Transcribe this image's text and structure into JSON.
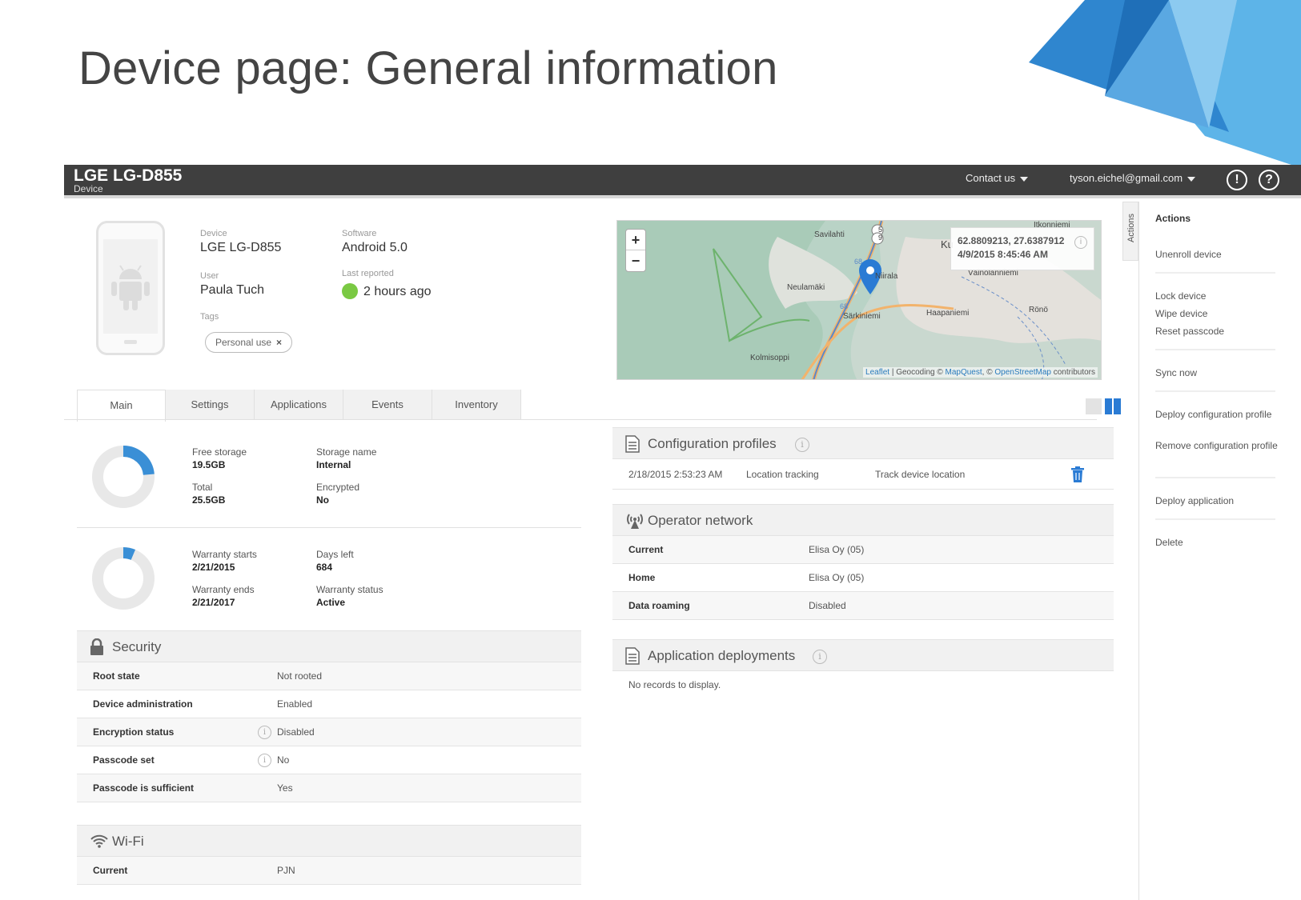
{
  "slide_title": "Device page: General information",
  "colors": {
    "topbar": "#3f3f3f",
    "accent_blue": "#3a8fd6",
    "green_status": "#7ac943",
    "donut_bg": "#e8e8e8"
  },
  "topbar": {
    "device_name": "LGE LG-D855",
    "device_sub": "Device",
    "contact_label": "Contact us",
    "user_email": "tyson.eichel@gmail.com",
    "alert_glyph": "!",
    "help_glyph": "?"
  },
  "device_info": {
    "device_label": "Device",
    "device_value": "LGE LG-D855",
    "software_label": "Software",
    "software_value": "Android 5.0",
    "user_label": "User",
    "user_value": "Paula Tuch",
    "last_reported_label": "Last reported",
    "last_reported_value": "2 hours ago",
    "tags_label": "Tags",
    "tag": "Personal use",
    "tag_remove": "×"
  },
  "map": {
    "zoom_in": "+",
    "zoom_out": "−",
    "coords": "62.8809213, 27.6387912",
    "timestamp": "4/9/2015 8:45:46 AM",
    "info_glyph": "i",
    "attr_leaflet": "Leaflet",
    "attr_geocoding": " | Geocoding © ",
    "attr_mapquest": "MapQuest",
    "attr_osm_prefix": ", © ",
    "attr_osm": "OpenStreetMap",
    "attr_contrib": " contributors",
    "places": [
      "Savilahti",
      "Itkonniemi",
      "Ku",
      "Neulamäki",
      "Niirala",
      "Väinölänniemi",
      "Särkiniemi",
      "Haapaniemi",
      "Rönö",
      "Kolmisoppi"
    ],
    "road_labels": [
      "5",
      "9",
      "68",
      "68"
    ]
  },
  "tabs": [
    "Main",
    "Settings",
    "Applications",
    "Events",
    "Inventory"
  ],
  "storage": {
    "free_label": "Free storage",
    "free_value": "19.5GB",
    "total_label": "Total",
    "total_value": "25.5GB",
    "name_label": "Storage name",
    "name_value": "Internal",
    "encrypted_label": "Encrypted",
    "encrypted_value": "No",
    "used_fraction": 0.235
  },
  "warranty": {
    "starts_label": "Warranty starts",
    "starts_value": "2/21/2015",
    "ends_label": "Warranty ends",
    "ends_value": "2/21/2017",
    "days_label": "Days left",
    "days_value": "684",
    "status_label": "Warranty status",
    "status_value": "Active",
    "elapsed_fraction": 0.063
  },
  "security": {
    "title": "Security",
    "rows": [
      {
        "key": "Root state",
        "value": "Not rooted"
      },
      {
        "key": "Device administration",
        "value": "Enabled"
      },
      {
        "key": "Encryption status",
        "value": "Disabled"
      },
      {
        "key": "Passcode set",
        "value": "No"
      },
      {
        "key": "Passcode is sufficient",
        "value": "Yes"
      }
    ]
  },
  "wifi": {
    "title": "Wi-Fi",
    "rows": [
      {
        "key": "Current",
        "value": "PJN"
      }
    ]
  },
  "config_profiles": {
    "title": "Configuration profiles",
    "info_glyph": "i",
    "rows": [
      {
        "date": "2/18/2015 2:53:23 AM",
        "name": "Location tracking",
        "description": "Track device location"
      }
    ]
  },
  "operator_network": {
    "title": "Operator network",
    "rows": [
      {
        "key": "Current",
        "value": "Elisa Oy (05)"
      },
      {
        "key": "Home",
        "value": "Elisa Oy (05)"
      },
      {
        "key": "Data roaming",
        "value": "Disabled"
      }
    ]
  },
  "app_deployments": {
    "title": "Application deployments",
    "info_glyph": "i",
    "empty": "No records to display."
  },
  "actions": {
    "tab_label": "Actions",
    "title": "Actions",
    "unenroll": "Unenroll device",
    "lock": "Lock device",
    "wipe": "Wipe device",
    "reset": "Reset passcode",
    "sync": "Sync now",
    "deploy_config": "Deploy configuration profile",
    "remove_config": "Remove configuration profile",
    "deploy_app": "Deploy application",
    "delete": "Delete"
  }
}
